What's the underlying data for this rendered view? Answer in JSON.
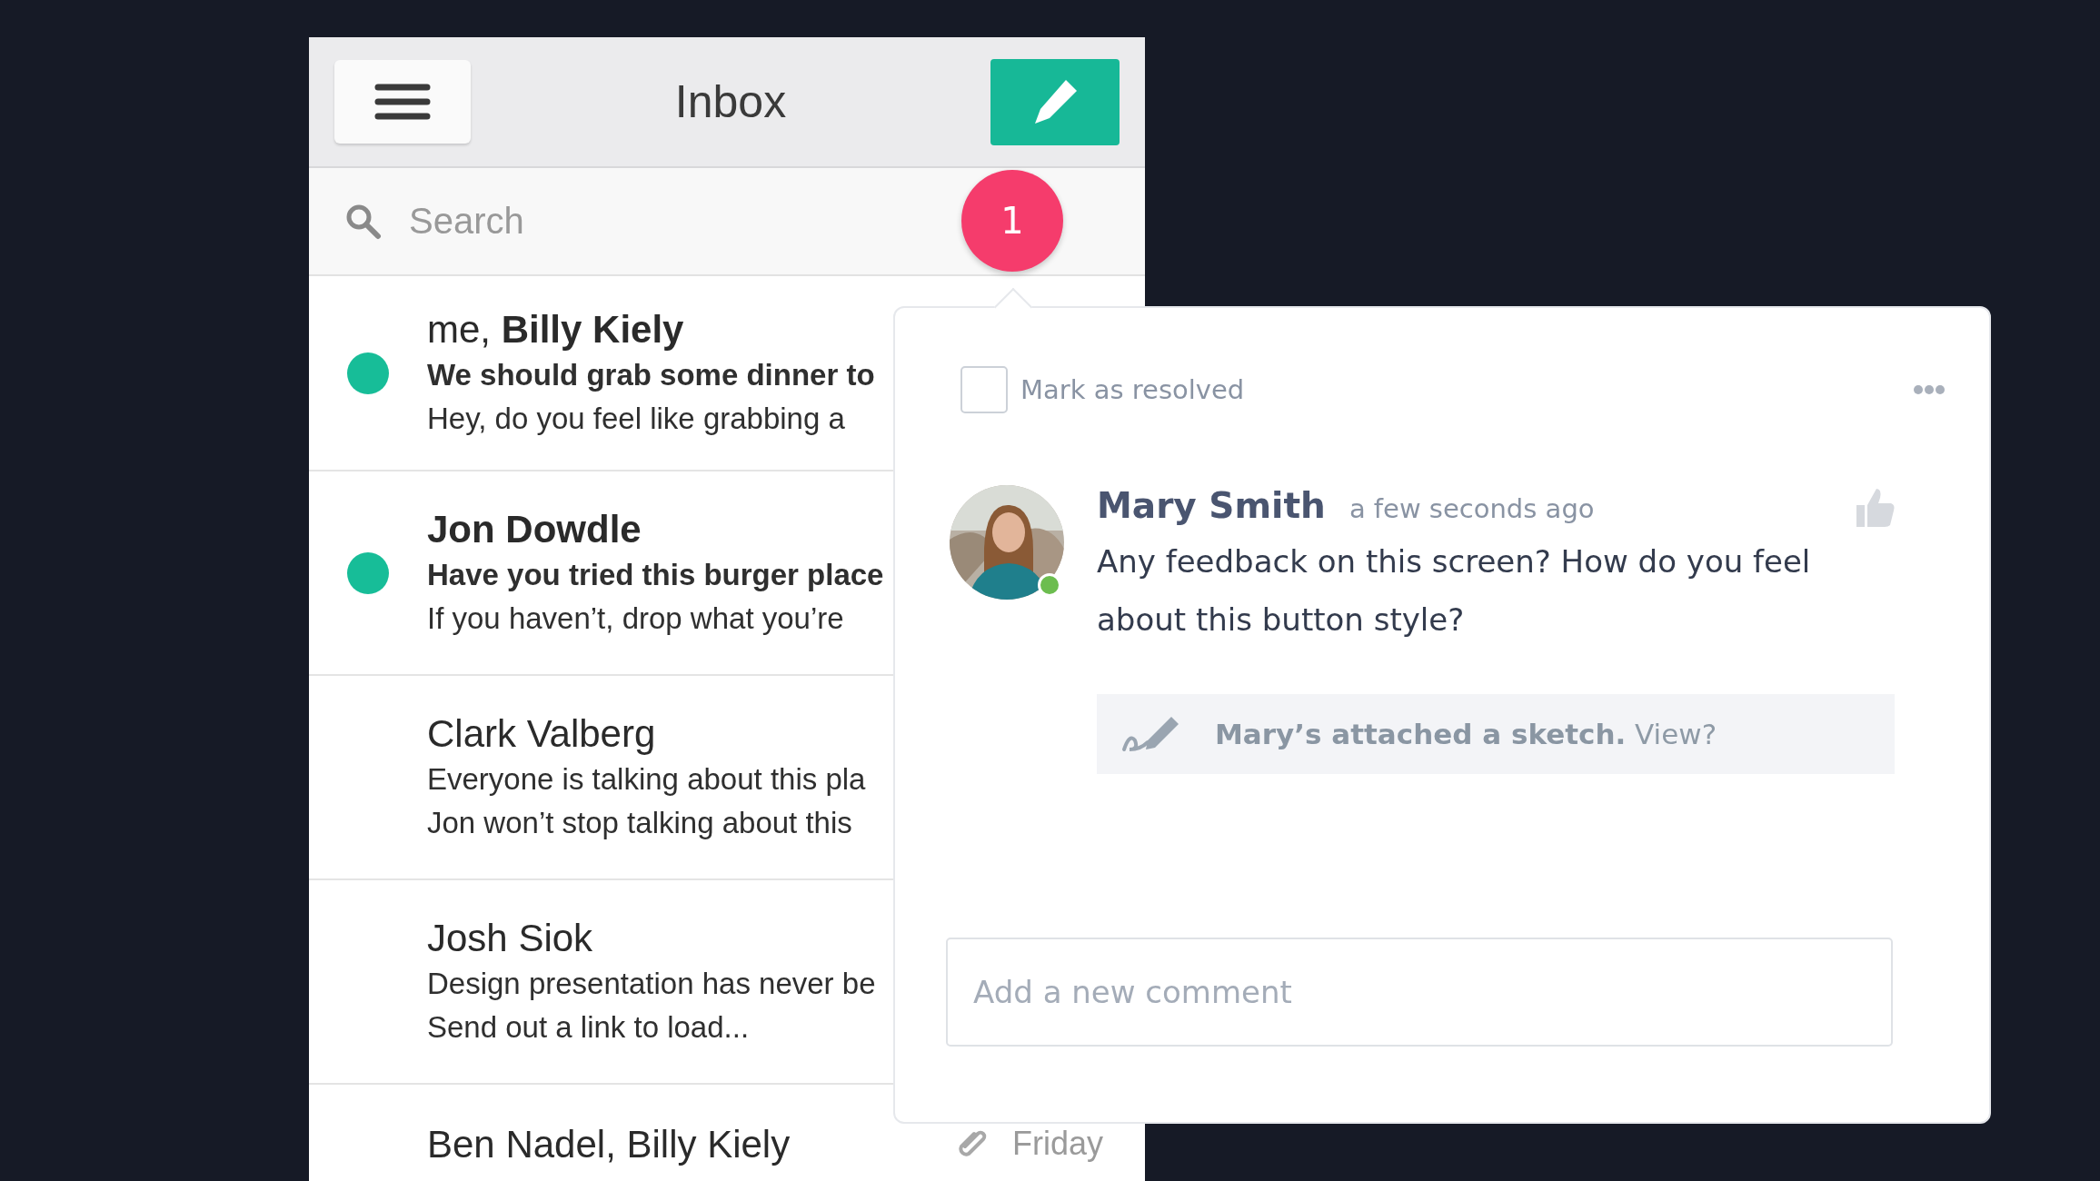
{
  "header": {
    "title": "Inbox"
  },
  "search": {
    "placeholder": "Search"
  },
  "notification_badge": "1",
  "messages": [
    {
      "name": "me, **Billy Kiely**",
      "name_bold": false,
      "unread": true,
      "lines": [
        "We should grab some dinner to",
        "Hey, do you feel like grabbing a"
      ]
    },
    {
      "name": "Jon Dowdle",
      "name_bold": true,
      "unread": true,
      "lines": [
        "Have you tried this burger place",
        "If you haven’t, drop what you’re"
      ]
    },
    {
      "name": "Clark Valberg",
      "name_bold": false,
      "unread": false,
      "lines": [
        "Everyone is talking about this pla",
        "Jon won’t stop talking about this"
      ]
    },
    {
      "name": "Josh Siok",
      "name_bold": false,
      "unread": false,
      "lines": [
        "Design presentation has never be",
        "Send out a link to load..."
      ]
    },
    {
      "name": "Ben Nadel, Billy Kiely",
      "name_bold": false,
      "unread": false,
      "attachment": true,
      "date": "Friday"
    }
  ],
  "comment_popover": {
    "resolve": {
      "label": "Mark as resolved",
      "checked": false
    },
    "comment": {
      "author": "Mary Smith",
      "online": true,
      "time": "a few seconds ago",
      "text": "Any feedback on this screen? How do you feel about this button style?",
      "attachment": "**Mary’s attached a sketch.** View?"
    },
    "new_comment": {
      "placeholder": "Add a new comment"
    }
  }
}
